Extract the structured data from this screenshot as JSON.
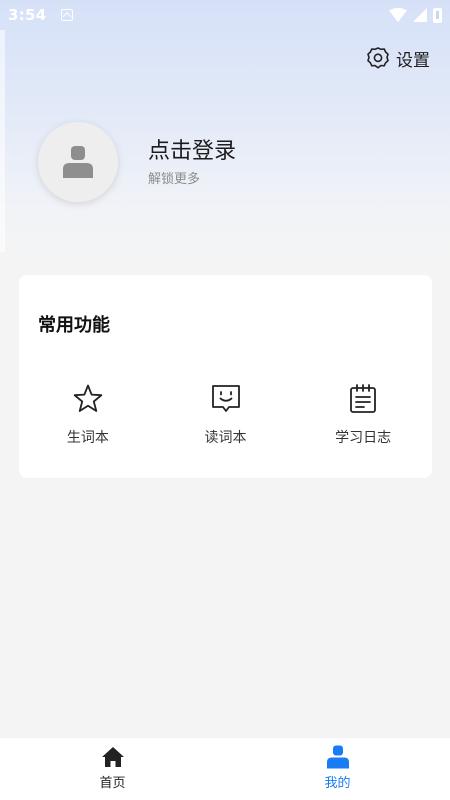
{
  "status_bar": {
    "time": "3:54",
    "icons": [
      "notification-icon",
      "wifi-icon",
      "signal-icon",
      "battery-icon"
    ]
  },
  "header": {
    "settings_label": "设置",
    "settings_icon": "gear-icon"
  },
  "profile": {
    "login_title": "点击登录",
    "login_subtitle": "解锁更多",
    "avatar_icon": "user-icon"
  },
  "common_functions": {
    "title": "常用功能",
    "items": [
      {
        "label": "生词本",
        "icon": "star-icon"
      },
      {
        "label": "读词本",
        "icon": "smile-message-icon"
      },
      {
        "label": "学习日志",
        "icon": "notebook-icon"
      }
    ]
  },
  "bottom_nav": {
    "items": [
      {
        "label": "首页",
        "icon": "home-icon",
        "active": false
      },
      {
        "label": "我的",
        "icon": "user-icon",
        "active": true
      }
    ]
  },
  "colors": {
    "accent": "#1a7cf5",
    "text_primary": "#1c1c1c",
    "text_secondary": "#8c8c8c",
    "background": "#f4f4f4",
    "hero_gradient_top": "#d6e1f8"
  }
}
